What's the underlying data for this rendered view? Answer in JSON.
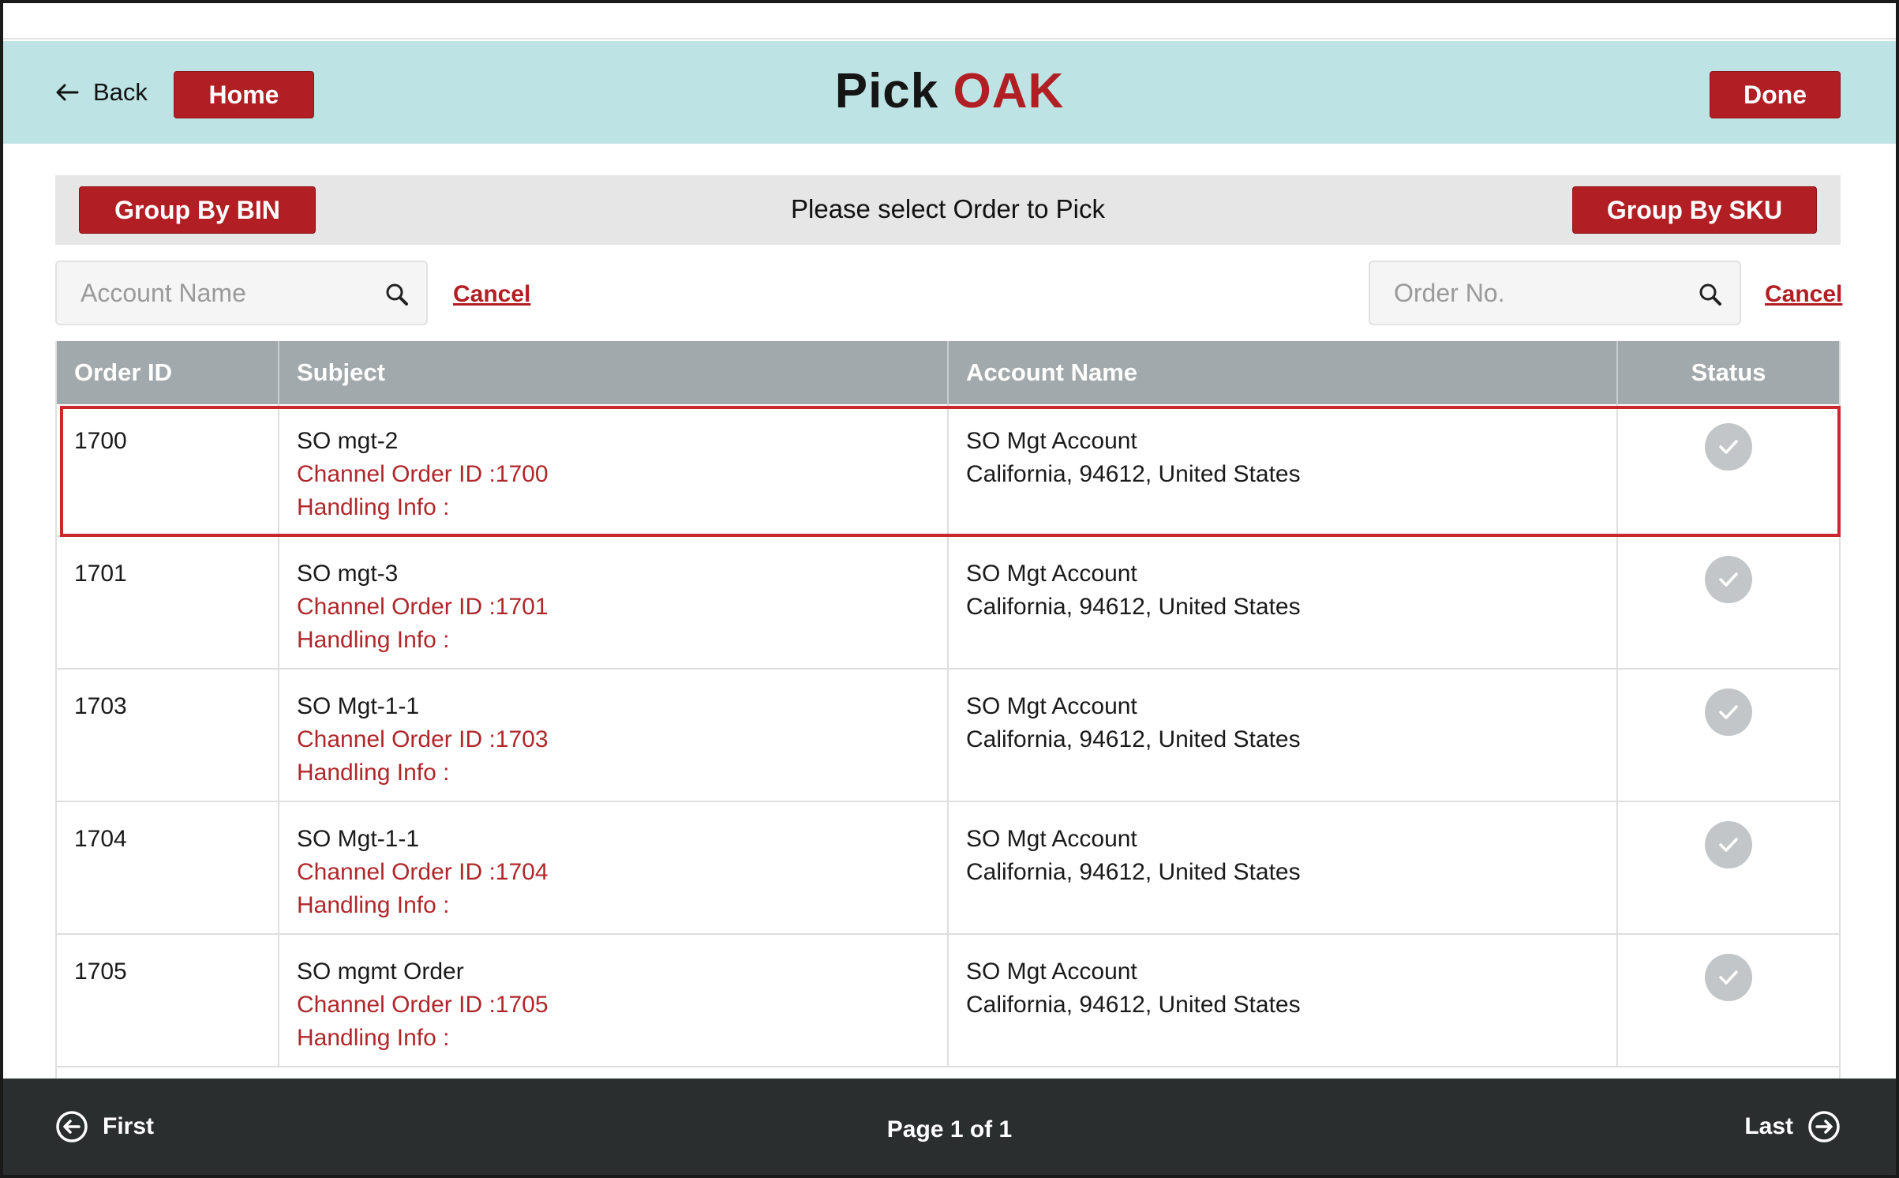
{
  "header": {
    "back_label": "Back",
    "home_label": "Home",
    "title_prefix": "Pick",
    "title_accent": "OAK",
    "done_label": "Done"
  },
  "group_bar": {
    "group_by_bin_label": "Group By BIN",
    "prompt": "Please select Order to Pick",
    "group_by_sku_label": "Group By SKU"
  },
  "search": {
    "account_placeholder": "Account Name",
    "account_cancel": "Cancel",
    "order_placeholder": "Order No.",
    "order_cancel": "Cancel"
  },
  "table": {
    "columns": [
      "Order ID",
      "Subject",
      "Account Name",
      "Status"
    ],
    "rows": [
      {
        "order_id": "1700",
        "subject": "SO mgt-2",
        "channel": "Channel Order ID :1700",
        "handling": "Handling Info :",
        "account": "SO Mgt Account",
        "address": "California, 94612, United States",
        "status": "checked",
        "selected": true
      },
      {
        "order_id": "1701",
        "subject": "SO mgt-3",
        "channel": "Channel Order ID :1701",
        "handling": "Handling Info :",
        "account": "SO Mgt Account",
        "address": "California, 94612, United States",
        "status": "checked",
        "selected": false
      },
      {
        "order_id": "1703",
        "subject": "SO Mgt-1-1",
        "channel": "Channel Order ID :1703",
        "handling": "Handling Info :",
        "account": "SO Mgt Account",
        "address": "California, 94612, United States",
        "status": "checked",
        "selected": false
      },
      {
        "order_id": "1704",
        "subject": "SO Mgt-1-1",
        "channel": "Channel Order ID :1704",
        "handling": "Handling Info :",
        "account": "SO Mgt Account",
        "address": "California, 94612, United States",
        "status": "checked",
        "selected": false
      },
      {
        "order_id": "1705",
        "subject": "SO mgmt Order",
        "channel": "Channel Order ID :1705",
        "handling": "Handling Info :",
        "account": "SO Mgt Account",
        "address": "California, 94612, United States",
        "status": "checked",
        "selected": false
      }
    ]
  },
  "footer": {
    "first_label": "First",
    "page_info": "Page 1 of 1",
    "last_label": "Last"
  },
  "icons": {
    "back": "arrow-left-icon",
    "search": "magnifier-icon",
    "status": "check-circle-icon",
    "first": "arrow-circle-left-icon",
    "last": "arrow-circle-right-icon"
  },
  "colors": {
    "accent": "#b11f24",
    "header_bg": "#bde3e4",
    "table_header_bg": "#a2a9ad",
    "footer_bg": "#2a2e2f"
  }
}
